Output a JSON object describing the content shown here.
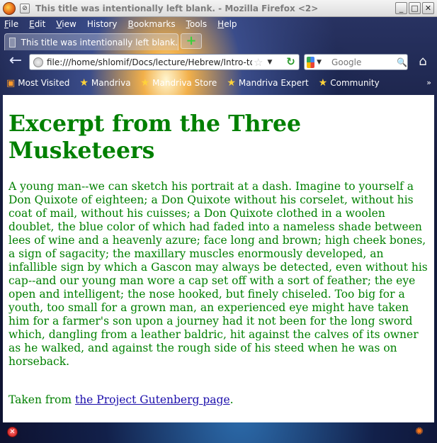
{
  "window": {
    "title": "This title was intentionally left blank. - Mozilla Firefox <2>",
    "small_button": "⊘",
    "minimize": "_",
    "maximize": "□",
    "close": "✕"
  },
  "menubar": {
    "items": [
      {
        "accel": "F",
        "rest": "ile"
      },
      {
        "accel": "E",
        "rest": "dit"
      },
      {
        "accel": "V",
        "rest": "iew"
      },
      {
        "accel": "Hi",
        "pre": "",
        "rest": "story"
      },
      {
        "accel": "B",
        "rest": "ookmarks"
      },
      {
        "accel": "T",
        "rest": "ools"
      },
      {
        "accel": "H",
        "rest": "elp"
      }
    ]
  },
  "tabs": {
    "active_title": "This title was intentionally left blank.",
    "new_tab": "+"
  },
  "navbar": {
    "url": "file:///home/shlomif/Docs/lecture/Hebrew/Intro-to-HTML",
    "search_placeholder": "Google"
  },
  "bookmarks": {
    "items": [
      {
        "label": "Most Visited",
        "icon": "rss-icon"
      },
      {
        "label": "Mandriva",
        "icon": "star-icon"
      },
      {
        "label": "Mandriva Store",
        "icon": "star-icon"
      },
      {
        "label": "Mandriva Expert",
        "icon": "star-icon"
      },
      {
        "label": "Community",
        "icon": "star-icon"
      }
    ],
    "more": "»"
  },
  "content": {
    "heading": "Excerpt from the Three Musketeers",
    "excerpt": "A young man--we can sketch his portrait at a dash. Imagine to yourself a Don Quixote of eighteen; a Don Quixote without his corselet, without his coat of mail, without his cuisses; a Don Quixote clothed in a woolen doublet, the blue color of which had faded into a nameless shade between lees of wine and a heavenly azure; face long and brown; high cheek bones, a sign of sagacity; the maxillary muscles enormously developed, an infallible sign by which a Gascon may always be detected, even without his cap--and our young man wore a cap set off with a sort of feather; the eye open and intelligent; the nose hooked, but finely chiseled. Too big for a youth, too small for a grown man, an experienced eye might have taken him for a farmer's son upon a journey had it not been for the long sword which, dangling from a leather baldric, hit against the calves of its owner as he walked, and against the rough side of his steed when he was on horseback.",
    "source_prefix": "Taken from ",
    "source_link": "the Project Gutenberg page",
    "source_suffix": "."
  },
  "colors": {
    "text_green": "#008000",
    "link_blue": "#1a0dab"
  }
}
